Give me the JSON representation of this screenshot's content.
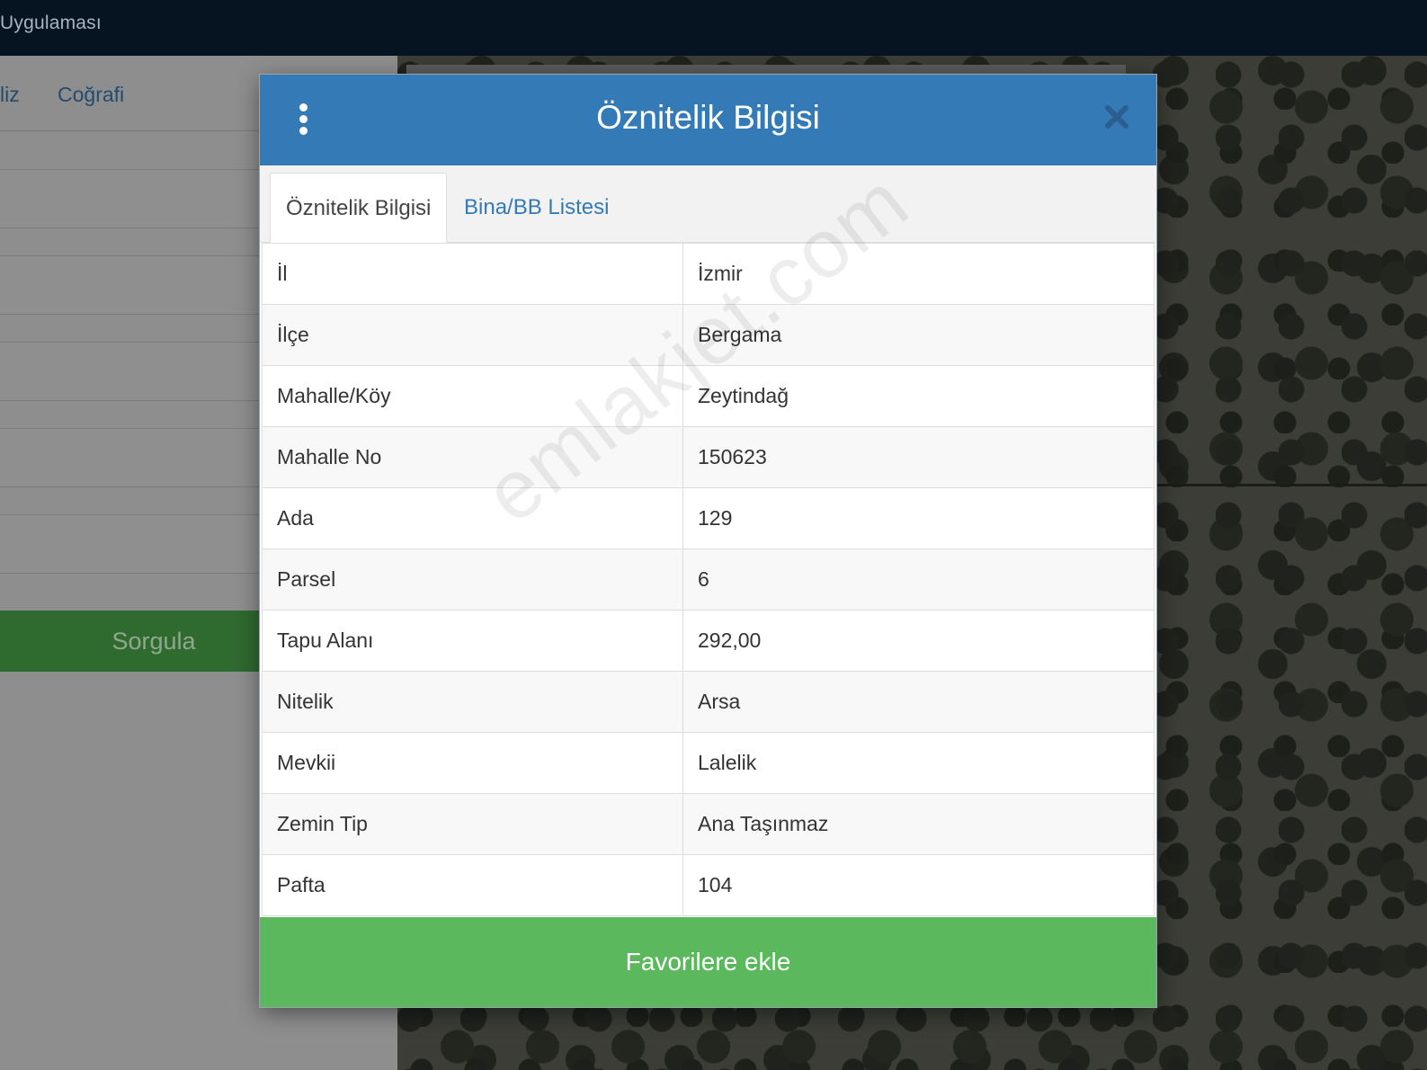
{
  "topbar": {
    "app_title": "Uygulaması"
  },
  "sidepanel": {
    "tabs": [
      {
        "label": "liz"
      },
      {
        "label": "Coğrafi"
      }
    ],
    "query_button": "Sorgula"
  },
  "modal": {
    "title": "Öznitelik Bilgisi",
    "menu_icon": "kebab-icon",
    "close_icon": "close-icon",
    "tabs": [
      {
        "label": "Öznitelik Bilgisi",
        "active": true
      },
      {
        "label": "Bina/BB Listesi",
        "active": false
      }
    ],
    "rows": [
      {
        "key": "İl",
        "value": "İzmir"
      },
      {
        "key": "İlçe",
        "value": "Bergama"
      },
      {
        "key": "Mahalle/Köy",
        "value": "Zeytindağ"
      },
      {
        "key": "Mahalle No",
        "value": "150623"
      },
      {
        "key": "Ada",
        "value": "129"
      },
      {
        "key": "Parsel",
        "value": "6"
      },
      {
        "key": "Tapu Alanı",
        "value": "292,00"
      },
      {
        "key": "Nitelik",
        "value": "Arsa"
      },
      {
        "key": "Mevkii",
        "value": "Lalelik"
      },
      {
        "key": "Zemin Tip",
        "value": "Ana Taşınmaz"
      },
      {
        "key": "Pafta",
        "value": "104"
      }
    ],
    "favorite_button": "Favorilere ekle"
  },
  "watermark": "emlakjet.com",
  "colors": {
    "header_blue": "#337ab7",
    "button_green": "#5cb85c",
    "topbar": "#061320"
  }
}
